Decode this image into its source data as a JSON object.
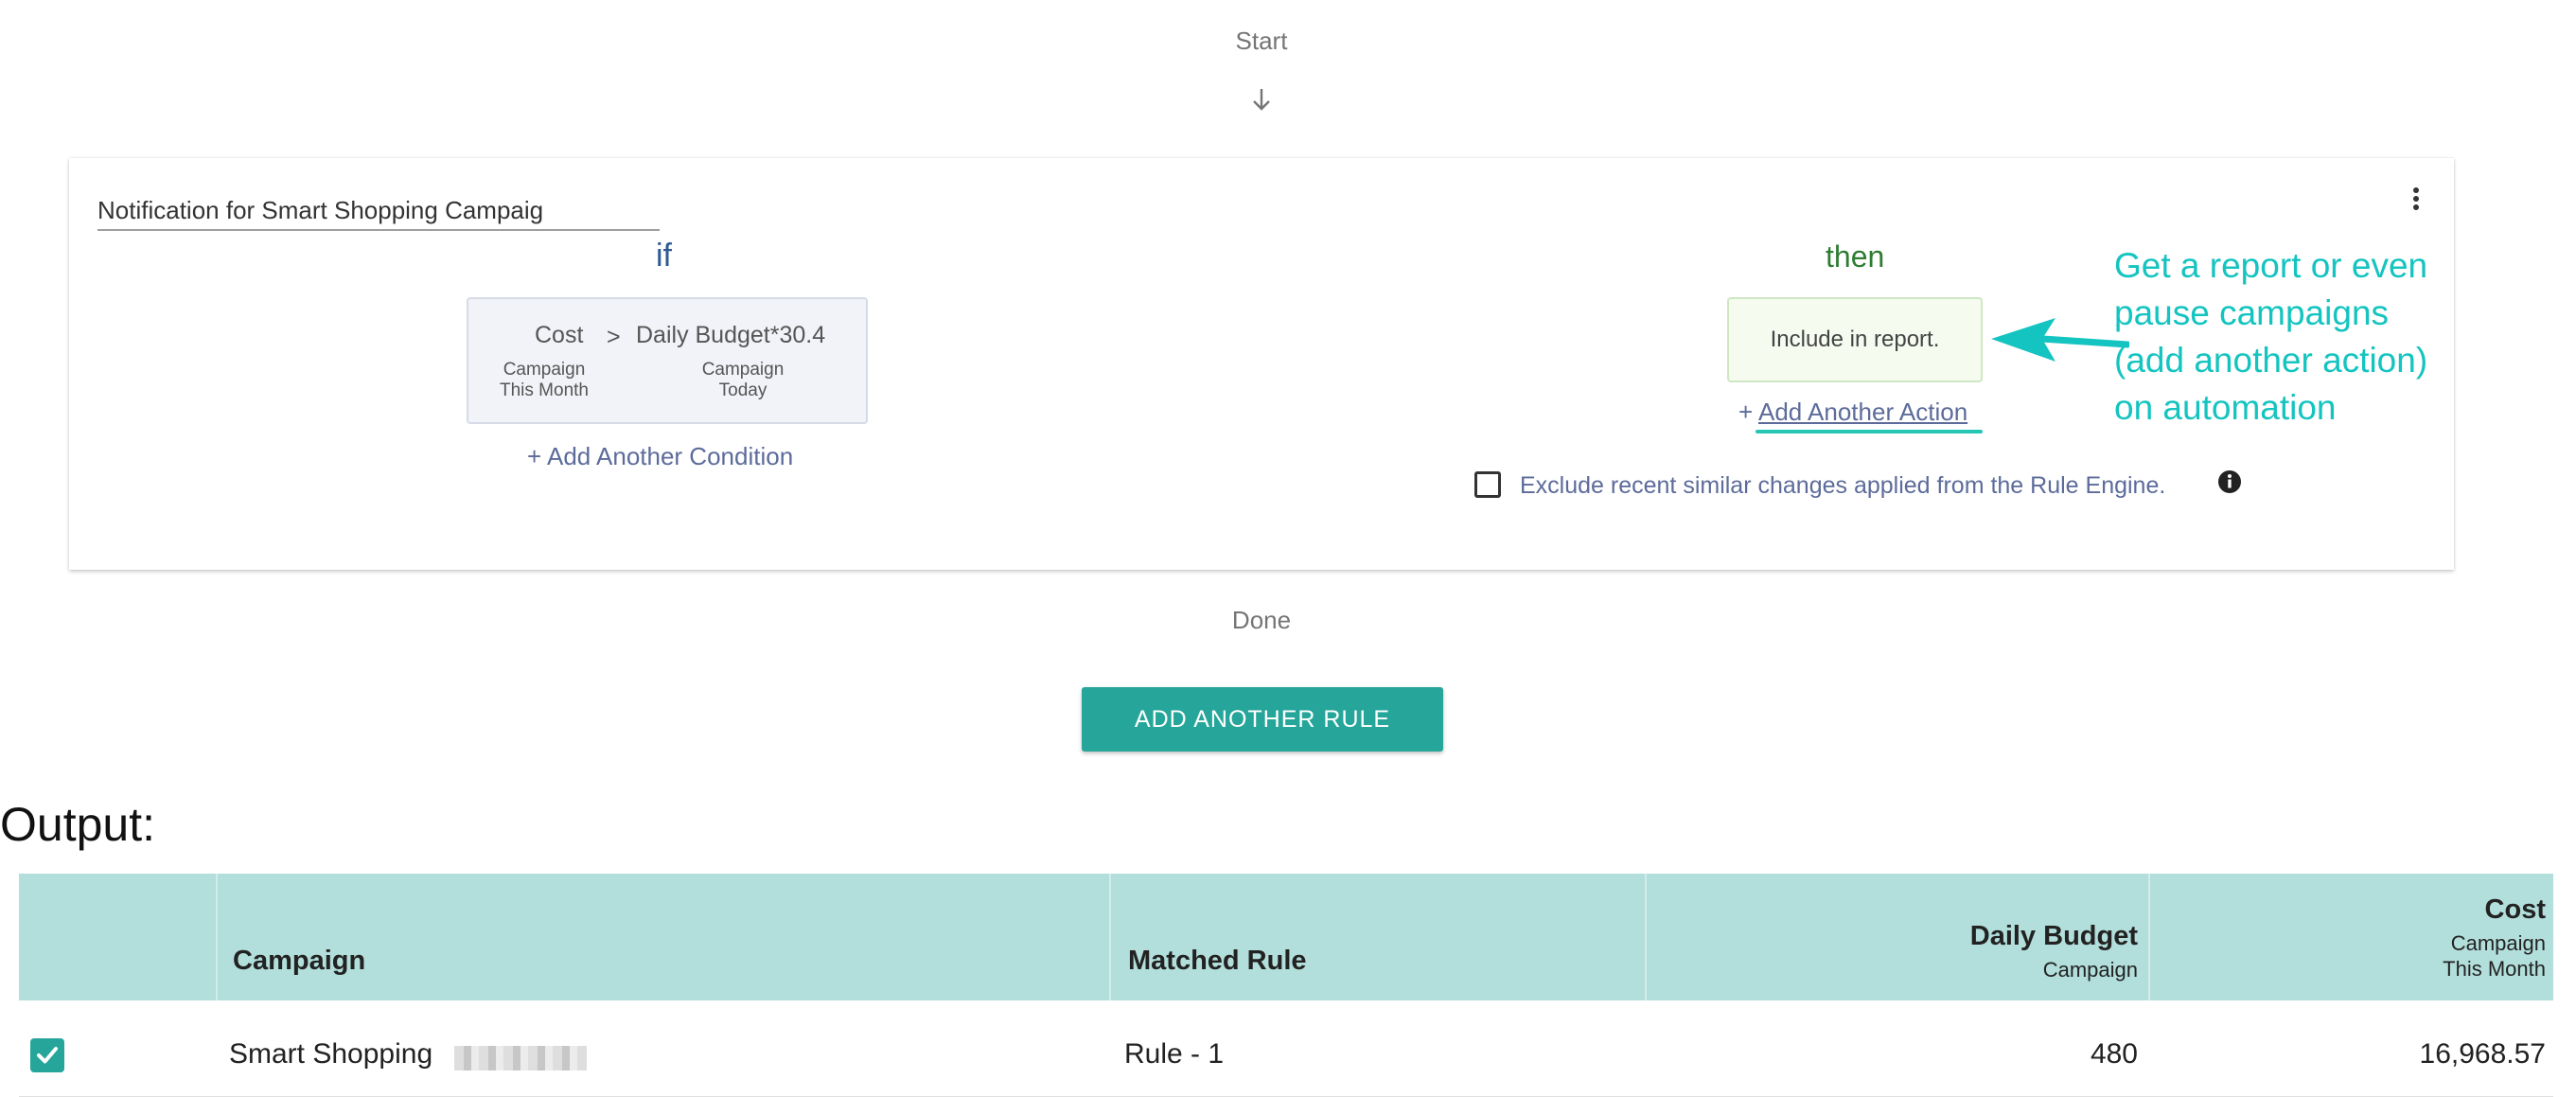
{
  "flow": {
    "start_label": "Start",
    "done_label": "Done"
  },
  "rule": {
    "name": "Notification for Smart Shopping Campaig",
    "if_label": "if",
    "then_label": "then",
    "condition": {
      "left_field": "Cost",
      "left_sub": "Campaign This Month",
      "operator": ">",
      "right_field": "Daily Budget*30.4",
      "right_sub": "Campaign Today"
    },
    "add_condition_label": "+ Add Another Condition",
    "action_label": "Include in report.",
    "add_action_prefix": "+",
    "add_action_label": "Add Another Action",
    "exclude_label": "Exclude recent similar changes applied from the Rule Engine.",
    "exclude_checked": false
  },
  "callout": {
    "text": "Get a report or even pause campaigns (add another action) on automation",
    "color": "#14c4c0"
  },
  "add_rule_button": "ADD ANOTHER RULE",
  "output_label": "Output:",
  "table": {
    "columns": {
      "campaign": "Campaign",
      "matched_rule": "Matched Rule",
      "daily_budget": "Daily Budget",
      "daily_budget_sub": "Campaign",
      "cost": "Cost",
      "cost_sub": "Campaign This Month"
    },
    "rows": [
      {
        "checked": true,
        "campaign": "Smart Shopping",
        "matched_rule": "Rule - 1",
        "daily_budget": "480",
        "cost": "16,968.57"
      }
    ]
  },
  "colors": {
    "accent": "#26a69a",
    "header_bg": "#b2dfdb",
    "if_color": "#2e5b94",
    "then_color": "#2e7d32",
    "link_color": "#5c6b9a"
  },
  "icons": [
    "arrow-down-icon",
    "more-vert-icon",
    "info-icon",
    "checkbox-icon",
    "check-icon",
    "callout-arrow-icon"
  ]
}
